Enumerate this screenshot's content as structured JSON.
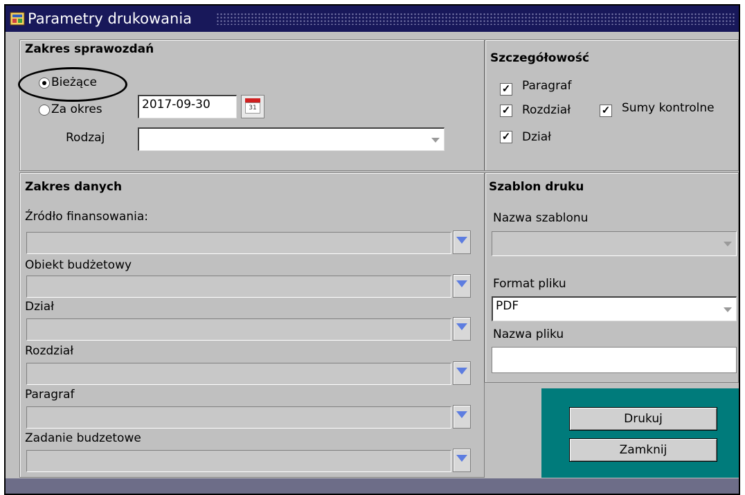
{
  "window": {
    "title": "Parametry drukowania"
  },
  "zakres_sprawozdan": {
    "title": "Zakres sprawozdań",
    "option_current": "Bieżące",
    "option_period": "Za okres",
    "date_value": "2017-09-30",
    "calendar_day": "31",
    "rodzaj_label": "Rodzaj",
    "rodzaj_value": ""
  },
  "szczegolowosc": {
    "title": "Szczegółowość",
    "paragraf": "Paragraf",
    "rozdzial": "Rozdział",
    "dzial": "Dział",
    "sumy": "Sumy kontrolne"
  },
  "zakres_danych": {
    "title": "Zakres danych",
    "zrodlo": "Źródło finansowania:",
    "obiekt": "Obiekt budżetowy",
    "dzial": "Dział",
    "rozdzial": "Rozdział",
    "paragraf": "Paragraf",
    "zadanie": "Zadanie budzetowe"
  },
  "szablon": {
    "title": "Szablon druku",
    "nazwa_label": "Nazwa szablonu",
    "nazwa_value": "",
    "format_label": "Format pliku",
    "format_value": "PDF",
    "plik_label": "Nazwa pliku",
    "plik_value": ""
  },
  "buttons": {
    "print": "Drukuj",
    "close": "Zamknij"
  },
  "colors": {
    "title_bar": "#18185a",
    "panel_bg": "#c0c0c0",
    "teal": "#007b7b",
    "lov_arrow": "#5d7de0"
  }
}
